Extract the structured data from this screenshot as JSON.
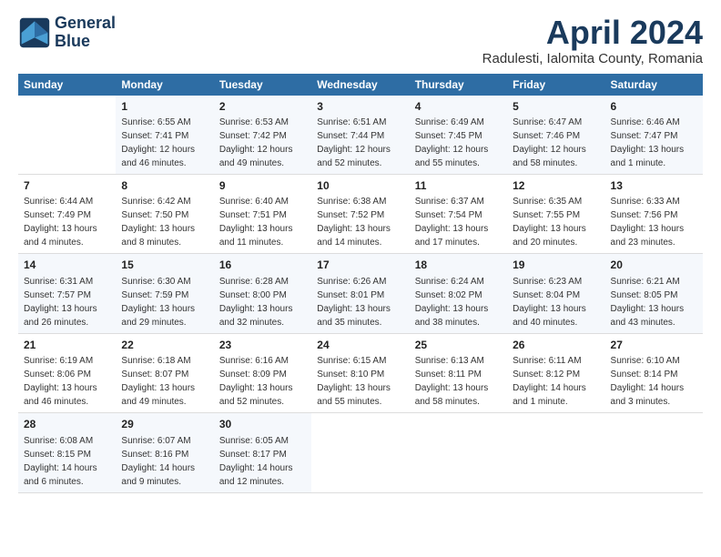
{
  "header": {
    "logo_line1": "General",
    "logo_line2": "Blue",
    "title": "April 2024",
    "location": "Radulesti, Ialomita County, Romania"
  },
  "days_of_week": [
    "Sunday",
    "Monday",
    "Tuesday",
    "Wednesday",
    "Thursday",
    "Friday",
    "Saturday"
  ],
  "weeks": [
    [
      {
        "num": "",
        "info": ""
      },
      {
        "num": "1",
        "info": "Sunrise: 6:55 AM\nSunset: 7:41 PM\nDaylight: 12 hours\nand 46 minutes."
      },
      {
        "num": "2",
        "info": "Sunrise: 6:53 AM\nSunset: 7:42 PM\nDaylight: 12 hours\nand 49 minutes."
      },
      {
        "num": "3",
        "info": "Sunrise: 6:51 AM\nSunset: 7:44 PM\nDaylight: 12 hours\nand 52 minutes."
      },
      {
        "num": "4",
        "info": "Sunrise: 6:49 AM\nSunset: 7:45 PM\nDaylight: 12 hours\nand 55 minutes."
      },
      {
        "num": "5",
        "info": "Sunrise: 6:47 AM\nSunset: 7:46 PM\nDaylight: 12 hours\nand 58 minutes."
      },
      {
        "num": "6",
        "info": "Sunrise: 6:46 AM\nSunset: 7:47 PM\nDaylight: 13 hours\nand 1 minute."
      }
    ],
    [
      {
        "num": "7",
        "info": "Sunrise: 6:44 AM\nSunset: 7:49 PM\nDaylight: 13 hours\nand 4 minutes."
      },
      {
        "num": "8",
        "info": "Sunrise: 6:42 AM\nSunset: 7:50 PM\nDaylight: 13 hours\nand 8 minutes."
      },
      {
        "num": "9",
        "info": "Sunrise: 6:40 AM\nSunset: 7:51 PM\nDaylight: 13 hours\nand 11 minutes."
      },
      {
        "num": "10",
        "info": "Sunrise: 6:38 AM\nSunset: 7:52 PM\nDaylight: 13 hours\nand 14 minutes."
      },
      {
        "num": "11",
        "info": "Sunrise: 6:37 AM\nSunset: 7:54 PM\nDaylight: 13 hours\nand 17 minutes."
      },
      {
        "num": "12",
        "info": "Sunrise: 6:35 AM\nSunset: 7:55 PM\nDaylight: 13 hours\nand 20 minutes."
      },
      {
        "num": "13",
        "info": "Sunrise: 6:33 AM\nSunset: 7:56 PM\nDaylight: 13 hours\nand 23 minutes."
      }
    ],
    [
      {
        "num": "14",
        "info": "Sunrise: 6:31 AM\nSunset: 7:57 PM\nDaylight: 13 hours\nand 26 minutes."
      },
      {
        "num": "15",
        "info": "Sunrise: 6:30 AM\nSunset: 7:59 PM\nDaylight: 13 hours\nand 29 minutes."
      },
      {
        "num": "16",
        "info": "Sunrise: 6:28 AM\nSunset: 8:00 PM\nDaylight: 13 hours\nand 32 minutes."
      },
      {
        "num": "17",
        "info": "Sunrise: 6:26 AM\nSunset: 8:01 PM\nDaylight: 13 hours\nand 35 minutes."
      },
      {
        "num": "18",
        "info": "Sunrise: 6:24 AM\nSunset: 8:02 PM\nDaylight: 13 hours\nand 38 minutes."
      },
      {
        "num": "19",
        "info": "Sunrise: 6:23 AM\nSunset: 8:04 PM\nDaylight: 13 hours\nand 40 minutes."
      },
      {
        "num": "20",
        "info": "Sunrise: 6:21 AM\nSunset: 8:05 PM\nDaylight: 13 hours\nand 43 minutes."
      }
    ],
    [
      {
        "num": "21",
        "info": "Sunrise: 6:19 AM\nSunset: 8:06 PM\nDaylight: 13 hours\nand 46 minutes."
      },
      {
        "num": "22",
        "info": "Sunrise: 6:18 AM\nSunset: 8:07 PM\nDaylight: 13 hours\nand 49 minutes."
      },
      {
        "num": "23",
        "info": "Sunrise: 6:16 AM\nSunset: 8:09 PM\nDaylight: 13 hours\nand 52 minutes."
      },
      {
        "num": "24",
        "info": "Sunrise: 6:15 AM\nSunset: 8:10 PM\nDaylight: 13 hours\nand 55 minutes."
      },
      {
        "num": "25",
        "info": "Sunrise: 6:13 AM\nSunset: 8:11 PM\nDaylight: 13 hours\nand 58 minutes."
      },
      {
        "num": "26",
        "info": "Sunrise: 6:11 AM\nSunset: 8:12 PM\nDaylight: 14 hours\nand 1 minute."
      },
      {
        "num": "27",
        "info": "Sunrise: 6:10 AM\nSunset: 8:14 PM\nDaylight: 14 hours\nand 3 minutes."
      }
    ],
    [
      {
        "num": "28",
        "info": "Sunrise: 6:08 AM\nSunset: 8:15 PM\nDaylight: 14 hours\nand 6 minutes."
      },
      {
        "num": "29",
        "info": "Sunrise: 6:07 AM\nSunset: 8:16 PM\nDaylight: 14 hours\nand 9 minutes."
      },
      {
        "num": "30",
        "info": "Sunrise: 6:05 AM\nSunset: 8:17 PM\nDaylight: 14 hours\nand 12 minutes."
      },
      {
        "num": "",
        "info": ""
      },
      {
        "num": "",
        "info": ""
      },
      {
        "num": "",
        "info": ""
      },
      {
        "num": "",
        "info": ""
      }
    ]
  ]
}
